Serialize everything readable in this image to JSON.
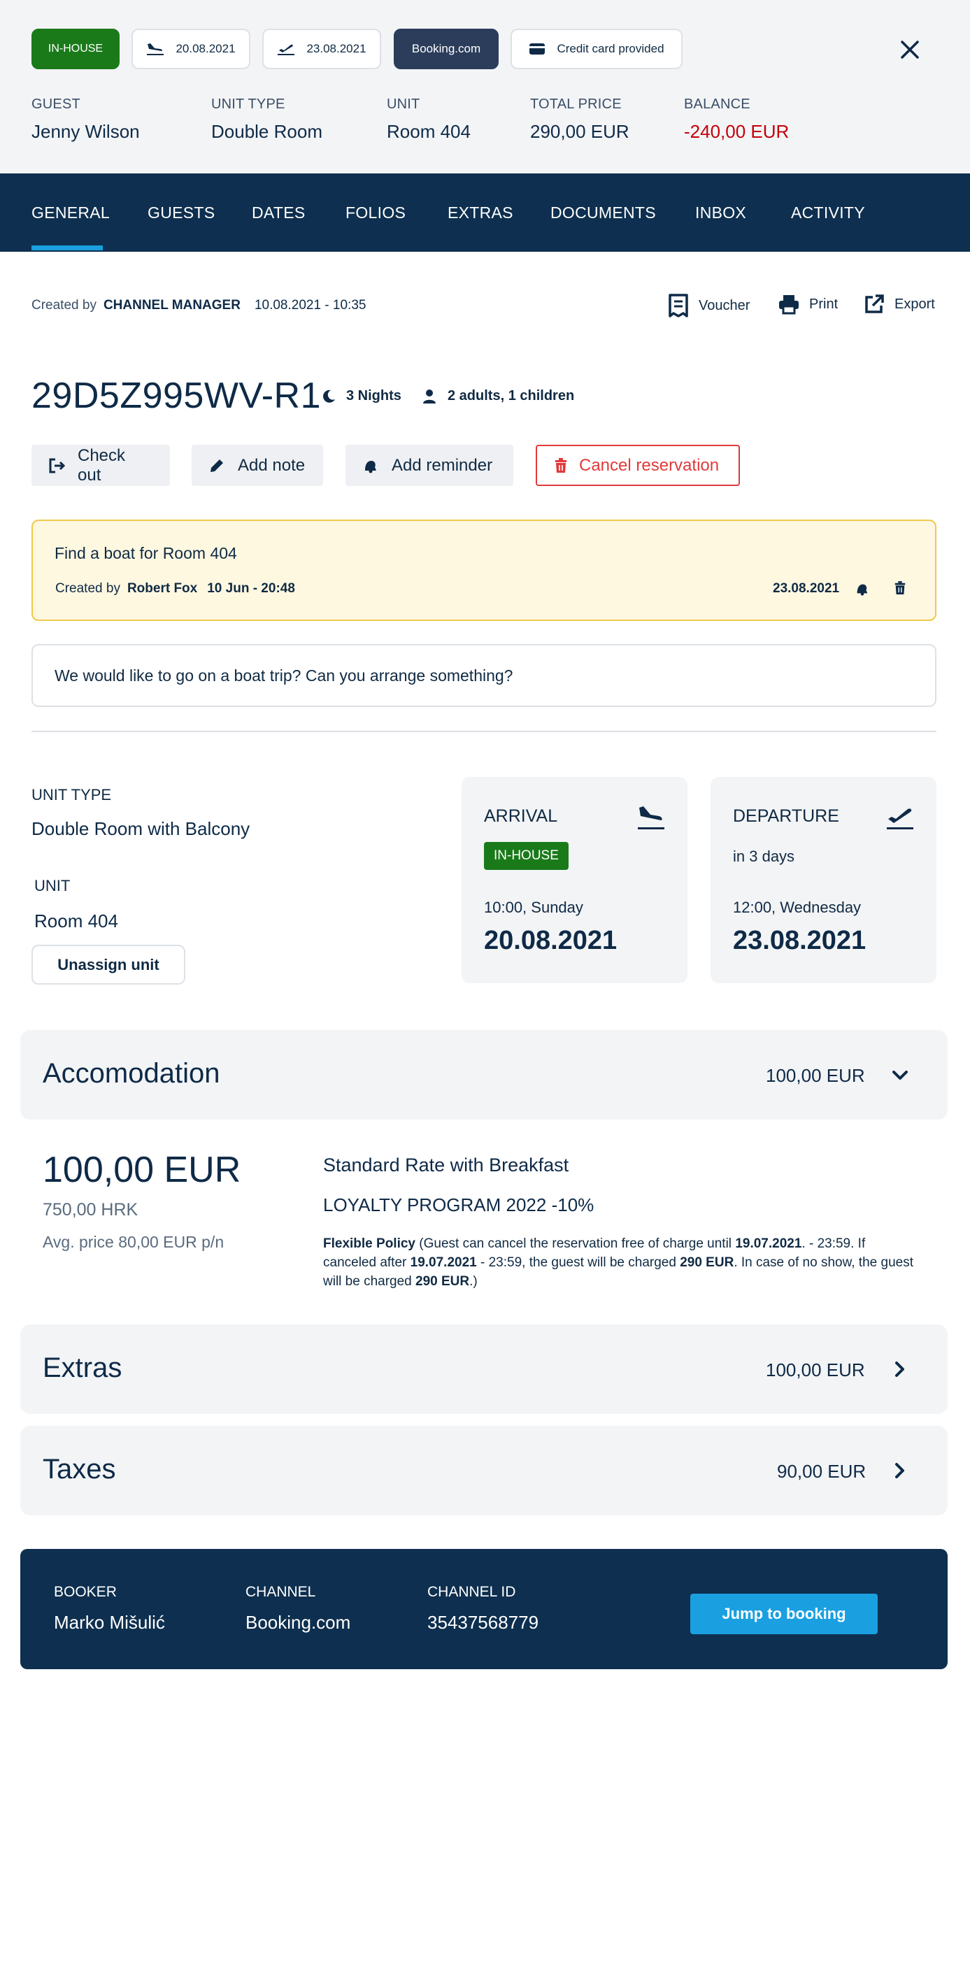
{
  "header": {
    "status_badge": "IN-HOUSE",
    "arrival_date": "20.08.2021",
    "departure_date": "23.08.2021",
    "channel_badge": "Booking.com",
    "payment_badge": "Credit card provided",
    "guest_label": "GUEST",
    "guest_value": "Jenny Wilson",
    "unit_type_label": "UNIT TYPE",
    "unit_type_value": "Double Room",
    "unit_label": "UNIT",
    "unit_value": "Room 404",
    "total_label": "TOTAL PRICE",
    "total_value": "290,00 EUR",
    "balance_label": "BALANCE",
    "balance_value": "-240,00 EUR",
    "balance_color": "#c4000a"
  },
  "tabs": [
    "GENERAL",
    "GUESTS",
    "DATES",
    "FOLIOS",
    "EXTRAS",
    "DOCUMENTS",
    "INBOX",
    "ACTIVITY"
  ],
  "meta": {
    "created_by_label": "Created by",
    "created_by": "CHANNEL MANAGER",
    "created_at": "10.08.2021 - 10:35",
    "voucher": "Voucher",
    "print": "Print",
    "export": "Export"
  },
  "reservation": {
    "code": "29D5Z995WV-R1",
    "nights": "3 Nights",
    "occupancy": "2 adults, 1 children"
  },
  "actions": {
    "check_out": "Check out",
    "add_note": "Add note",
    "add_reminder": "Add reminder",
    "cancel": "Cancel reservation"
  },
  "reminder": {
    "title": "Find a boat for Room 404",
    "created_by_label": "Created by",
    "author": "Robert Fox",
    "created_at": "10 Jun - 20:48",
    "due_date": "23.08.2021"
  },
  "note": {
    "text": "We would like to go on a boat trip? Can you arrange something?"
  },
  "unit_section": {
    "unit_type_label": "UNIT TYPE",
    "unit_type_value": "Double Room with Balcony",
    "unit_label": "UNIT",
    "unit_value": "Room 404",
    "unassign": "Unassign unit"
  },
  "arrival": {
    "label": "ARRIVAL",
    "badge": "IN-HOUSE",
    "time": "10:00, Sunday",
    "date": "20.08.2021"
  },
  "departure": {
    "label": "DEPARTURE",
    "relative": "in 3 days",
    "time": "12:00, Wednesday",
    "date": "23.08.2021"
  },
  "accommodation": {
    "title": "Accomodation",
    "amount": "100,00 EUR",
    "price_main": "100,00 EUR",
    "price_alt": "750,00 HRK",
    "avg": "Avg. price 80,00 EUR p/n",
    "rate": "Standard Rate with Breakfast",
    "program": "LOYALTY PROGRAM 2022 -10%",
    "policy_name": "Flexible Policy",
    "policy_p1": " (Guest can cancel the reservation free of charge until ",
    "policy_date1": "19.07.2021",
    "policy_p2": ". - 23:59. If canceled after ",
    "policy_date2": "19.07.2021",
    "policy_p3": " - 23:59, the guest will be charged ",
    "policy_amount1": "290 EUR",
    "policy_p4": ". In case of no show, the guest will be charged ",
    "policy_amount2": "290 EUR",
    "policy_p5": ".)"
  },
  "extras": {
    "title": "Extras",
    "amount": "100,00 EUR"
  },
  "taxes": {
    "title": "Taxes",
    "amount": "90,00 EUR"
  },
  "footer": {
    "booker_label": "BOOKER",
    "booker_value": "Marko Mišulić",
    "channel_label": "CHANNEL",
    "channel_value": "Booking.com",
    "channel_id_label": "CHANNEL ID",
    "channel_id_value": "35437568779",
    "jump": "Jump to booking"
  },
  "colors": {
    "navy": "#0e2f4f",
    "accent_blue": "#1aa0e0",
    "inhouse_green": "#1a7a1a",
    "cancel_red": "#e03a3a",
    "reminder_bg": "#fff8e1",
    "reminder_border": "#f0c94a"
  }
}
